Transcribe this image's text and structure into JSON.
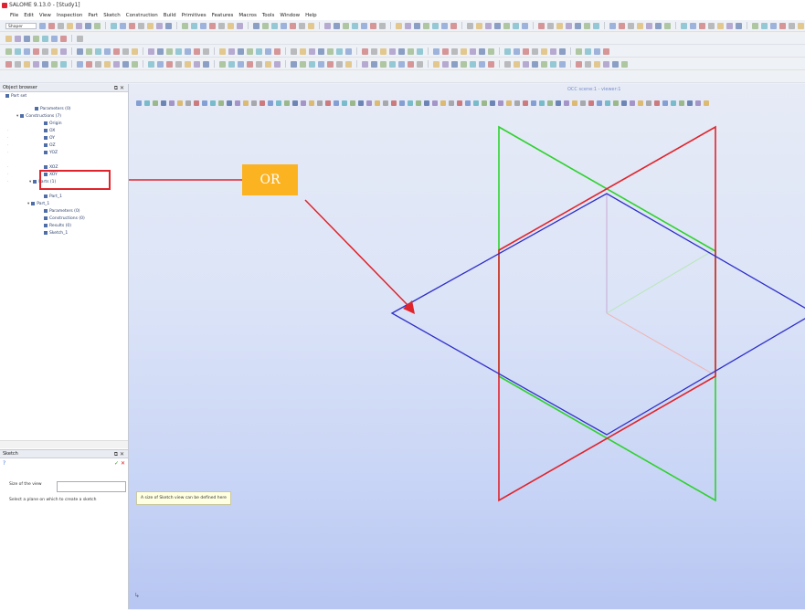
{
  "app": {
    "title": "SALOME 9.13.0 - [Study1]"
  },
  "menu": [
    "File",
    "Edit",
    "View",
    "Inspection",
    "Part",
    "Sketch",
    "Construction",
    "Build",
    "Primitives",
    "Features",
    "Macros",
    "Tools",
    "Window",
    "Help"
  ],
  "toolbar": {
    "module_combo": "Shaper",
    "selection_combo": ""
  },
  "object_browser": {
    "title": "Object browser",
    "items": [
      {
        "label": "Part set",
        "level": 0
      },
      {
        "label": "Parameters (0)",
        "level": 2
      },
      {
        "label": "Constructions (7)",
        "level": 1
      },
      {
        "label": "Origin",
        "level": 3
      },
      {
        "label": "OX",
        "level": 3
      },
      {
        "label": "OY",
        "level": 3
      },
      {
        "label": "OZ",
        "level": 3
      },
      {
        "label": "YOZ",
        "level": 3
      },
      {
        "label": "XOZ",
        "level": 3
      },
      {
        "label": "XOY",
        "level": 3
      },
      {
        "label": "Parts (1)",
        "level": 1
      },
      {
        "label": "Part_1",
        "level": 3
      },
      {
        "label": "Part_1",
        "level": 1
      },
      {
        "label": "Parameters (0)",
        "level": 2
      },
      {
        "label": "Constructions (0)",
        "level": 2
      },
      {
        "label": "Results (0)",
        "level": 2
      },
      {
        "label": "Sketch_1",
        "level": 2
      }
    ]
  },
  "sketch_panel": {
    "title": "Sketch",
    "size_label": "Size of the view",
    "size_value": "",
    "hint": "Select a plane on which to create a sketch"
  },
  "viewport": {
    "title": "OCC scene:1 - viewer:1",
    "tooltip": "A size of Sketch view can be defined here",
    "annotation": "OR"
  },
  "colors": {
    "plane_red": "#e0242c",
    "plane_green": "#2fd12f",
    "plane_blue": "#2f2fc8",
    "annotation_bg": "#fcb322",
    "highlight": "#e0242c"
  }
}
